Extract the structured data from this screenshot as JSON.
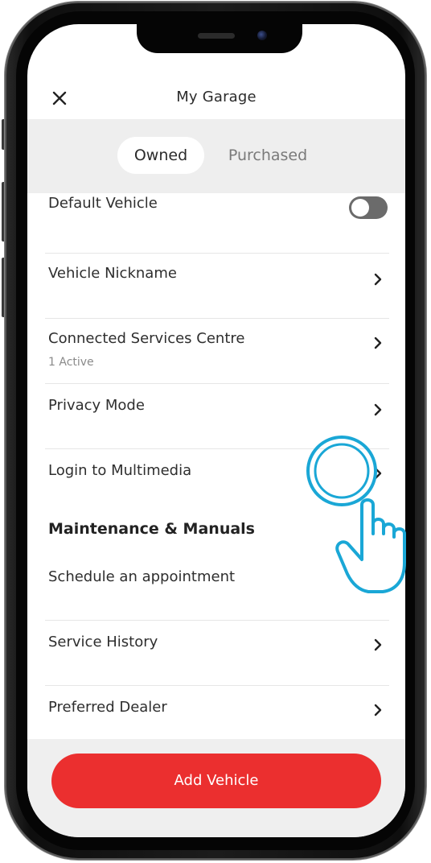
{
  "header": {
    "title": "My Garage",
    "close_icon": "close-icon"
  },
  "tabs": [
    {
      "label": "Owned",
      "selected": true
    },
    {
      "label": "Purchased",
      "selected": false
    }
  ],
  "settings": {
    "default_vehicle": {
      "label": "Default Vehicle",
      "toggle_on": false
    },
    "vehicle_nickname": {
      "label": "Vehicle Nickname"
    },
    "connected_services": {
      "label": "Connected Services Centre",
      "sublabel": "1 Active"
    },
    "privacy_mode": {
      "label": "Privacy Mode"
    },
    "login_multimedia": {
      "label": "Login to Multimedia"
    }
  },
  "maintenance": {
    "section_title": "Maintenance & Manuals",
    "items": [
      {
        "label": "Schedule an appointment"
      },
      {
        "label": "Service History"
      },
      {
        "label": "Preferred Dealer"
      }
    ]
  },
  "footer": {
    "add_vehicle_label": "Add Vehicle"
  },
  "colors": {
    "accent_red": "#eb2f2f",
    "tap_hint_blue": "#1aa7d6",
    "toggle_off": "#6b6b6b",
    "tab_bar_bg": "#eeeeee"
  },
  "icons": [
    "close-icon",
    "chevron-right-icon",
    "tap-hand-icon"
  ]
}
